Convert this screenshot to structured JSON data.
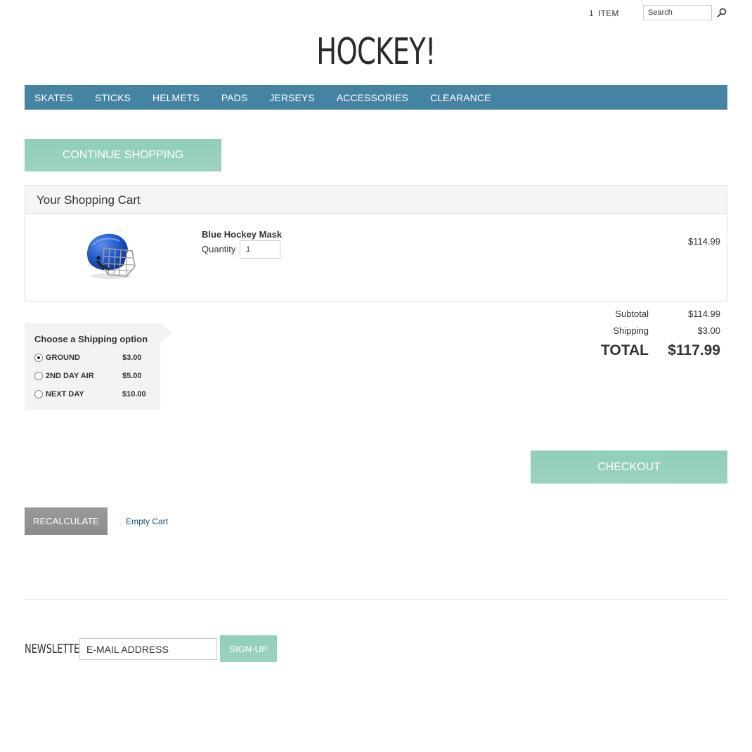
{
  "header": {
    "cart_count": "1",
    "cart_label": "ITEM",
    "search_placeholder": "Search",
    "logo": "HOCKEY!"
  },
  "nav": {
    "items": [
      "SKATES",
      "STICKS",
      "HELMETS",
      "PADS",
      "JERSEYS",
      "ACCESSORIES",
      "CLEARANCE"
    ]
  },
  "actions": {
    "continue_shopping": "CONTINUE SHOPPING",
    "checkout": "CHECKOUT",
    "recalculate": "RECALCULATE",
    "empty_cart": "Empty Cart"
  },
  "cart": {
    "title": "Your Shopping Cart",
    "items": [
      {
        "name": "Blue Hockey Mask",
        "quantity_label": "Quantity",
        "quantity": "1",
        "price": "$114.99",
        "image_icon": "hockey-helmet-icon"
      }
    ]
  },
  "totals": {
    "subtotal_label": "Subtotal",
    "subtotal": "$114.99",
    "shipping_label": "Shipping",
    "shipping": "$3.00",
    "total_label": "TOTAL",
    "total": "$117.99"
  },
  "shipping_options": {
    "title": "Choose a Shipping option",
    "options": [
      {
        "name": "GROUND",
        "price": "$3.00",
        "selected": true
      },
      {
        "name": "2ND DAY AIR",
        "price": "$5.00",
        "selected": false
      },
      {
        "name": "NEXT DAY",
        "price": "$10.00",
        "selected": false
      }
    ]
  },
  "newsletter": {
    "label": "NEWSLETTER",
    "placeholder": "E-MAIL ADDRESS",
    "button": "SIGN-UP"
  },
  "colors": {
    "nav_bg": "#4583a3",
    "accent_green": "#94d0bb",
    "recalc_gray": "#939393",
    "link_blue": "#1d4f7a"
  }
}
